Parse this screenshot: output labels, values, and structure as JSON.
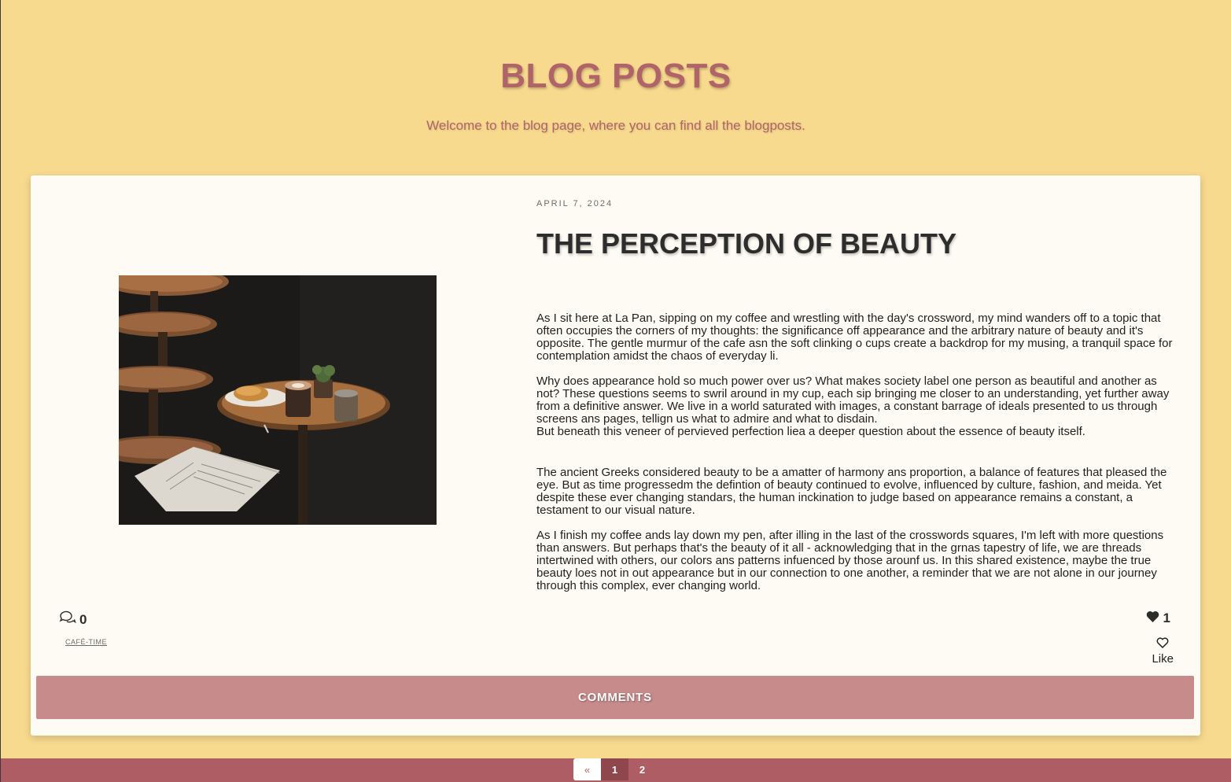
{
  "header": {
    "title": "BLOG POSTS",
    "subtitle": "Welcome to the blog page, where you can find all the blogposts."
  },
  "post": {
    "date": "APRIL 7, 2024",
    "title": "THE PERCEPTION OF BEAUTY",
    "paragraphs": [
      "As I sit here at La Pan, sipping on my coffee and wrestling with the day's  crossword, my mind wanders off to a topic that often occupies the corners of my thoughts: the significance off appearance and the arbitrary nature of beauty and it's opposite. The gentle murmur of the cafe asn the soft clinking o cups create a backdrop for my musing,  a tranquil space for contemplation amidst the chaos of everyday li.",
      "Why does appearance hold so much power over us? What makes society label one person as beautiful and another as not? These questions seems to swril around in my cup, each sip bringing me closer to an understanding, yet further away from a definitive answer. We live in a world saturated with images, a constant barrage of ideals presented to us through screens ans pages, tellign us what to admire and what to disdain.",
      "But beneath this veneer of pervieved perfection liea a deeper question about the essence of beauty itself.",
      "The ancient Greeks considered beauty to be a amatter of harmony ans proportion, a balance of features that pleased the eye. But as time progressedm the defintion of beauty continued to evolve, influenced by culture, fashion, and meida. Yet despite these ever changing standars, the human inckination to judge based on appearance remains a constant, a testament to our visual nature.",
      "As I finish my coffee ands lay down my pen, after illing in the last of the crosswords squares, I'm left with more questions than answers. But perhaps that's the beauty of it all - acknowledging that in the grnas tapestry of life, we are threads intertwined with others, our colors ans patterns infuenced by those arounf us. In this shared existence, maybe the true beauty loes not in out appearance but in our connection to one another, a reminder that we are not alone in our journey through this complex, ever changing world."
    ],
    "comment_count": "0",
    "tag": "CAFÉ-TIME",
    "like_count": "1",
    "like_label": "Like",
    "comments_button": "COMMENTS"
  },
  "pagination": {
    "prev": "«",
    "pages": [
      "1",
      "2"
    ],
    "active": "1"
  },
  "colors": {
    "background": "#f8da8e",
    "accent": "#b06469",
    "card": "#fefbf4",
    "comments_bar": "#c78b8c",
    "footer": "#ad5d63"
  },
  "icons": {
    "comment": "chat-bubbles-icon",
    "like_filled": "heart-filled-icon",
    "like_outline": "heart-outline-icon"
  }
}
